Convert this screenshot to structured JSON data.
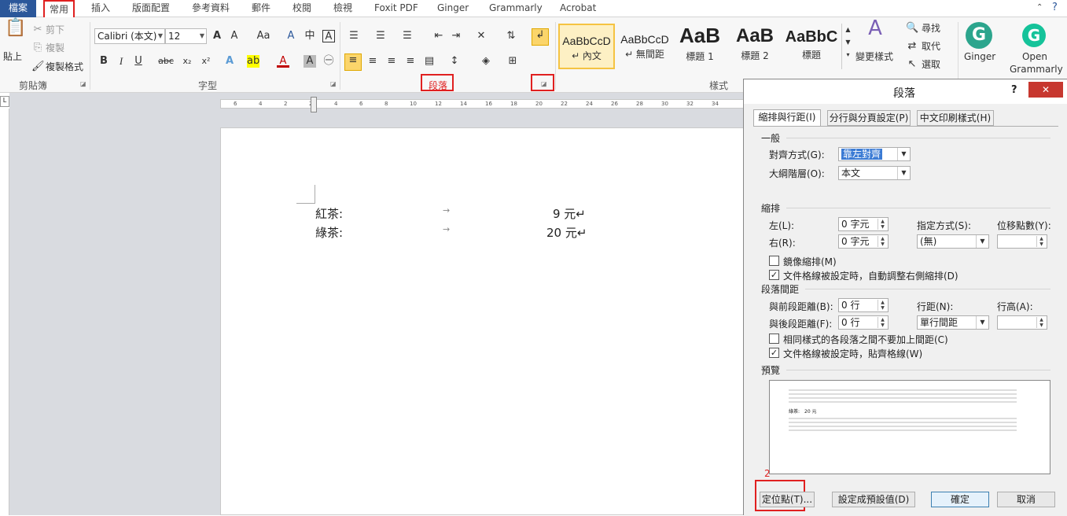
{
  "tabs": {
    "file": "檔案",
    "home": "常用",
    "insert": "插入",
    "layout": "版面配置",
    "refs": "參考資料",
    "mail": "郵件",
    "review": "校閱",
    "view": "檢視",
    "foxit": "Foxit PDF",
    "ginger": "Ginger",
    "grammarly": "Grammarly",
    "acrobat": "Acrobat"
  },
  "clipboard": {
    "paste": "貼上",
    "cut": "剪下",
    "copy": "複製",
    "format_painter": "複製格式",
    "group": "剪貼簿"
  },
  "font": {
    "name": "Calibri (本文)",
    "size": "12",
    "group": "字型",
    "bold": "B",
    "italic": "I",
    "underline": "U",
    "strike": "abc",
    "sub": "x₂",
    "sup": "x²"
  },
  "paragraph": {
    "group": "段落"
  },
  "styles": {
    "group": "樣式",
    "items": [
      {
        "sample": "AaBbCcD",
        "name": "↵ 內文"
      },
      {
        "sample": "AaBbCcD",
        "name": "↵ 無間距"
      },
      {
        "sample": "AaB",
        "name": "標題 1"
      },
      {
        "sample": "AaB",
        "name": "標題 2"
      },
      {
        "sample": "AaBbC",
        "name": "標題"
      }
    ],
    "change": "變更樣式"
  },
  "editing": {
    "find": "尋找",
    "replace": "取代",
    "select": "選取"
  },
  "ginger_btn": "Ginger",
  "grammarly_btn": "Open Grammarly",
  "annotations": {
    "one": "1",
    "two": "2"
  },
  "document": {
    "lines": [
      {
        "item": "紅茶:",
        "arrow": "→",
        "price": "9 元↵"
      },
      {
        "item": "綠茶:",
        "arrow": "→",
        "price": "20 元↵"
      }
    ]
  },
  "ruler_labels": [
    "6",
    "4",
    "2",
    "2",
    "4",
    "6",
    "8",
    "10",
    "12",
    "14",
    "16",
    "18",
    "20",
    "22",
    "24",
    "26",
    "28",
    "30",
    "32",
    "34"
  ],
  "dialog": {
    "title": "段落",
    "help": "?",
    "close": "✕",
    "tabs": [
      "縮排與行距(I)",
      "分行與分頁設定(P)",
      "中文印刷樣式(H)"
    ],
    "general": "一般",
    "alignment_label": "對齊方式(G):",
    "alignment_value": "靠左對齊",
    "outline_label": "大綱階層(O):",
    "outline_value": "本文",
    "indent": "縮排",
    "left_label": "左(L):",
    "left_value": "0 字元",
    "right_label": "右(R):",
    "right_value": "0 字元",
    "special_label": "指定方式(S):",
    "special_value": "(無)",
    "by_label": "位移點數(Y):",
    "mirror": "鏡像縮排(M)",
    "auto_adjust": "文件格線被設定時，自動調整右側縮排(D)",
    "spacing": "段落間距",
    "before_label": "與前段距離(B):",
    "before_value": "0 行",
    "after_label": "與後段距離(F):",
    "after_value": "0 行",
    "line_spacing_label": "行距(N):",
    "line_spacing_value": "單行間距",
    "at_label": "行高(A):",
    "no_space": "相同樣式的各段落之間不要加上間距(C)",
    "snap_grid": "文件格線被設定時，貼齊格線(W)",
    "preview": "預覽",
    "preview_item": "綠茶:",
    "preview_price": "20 元",
    "tabs_btn": "定位點(T)...",
    "default_btn": "設定成預設值(D)",
    "ok": "確定",
    "cancel": "取消"
  }
}
